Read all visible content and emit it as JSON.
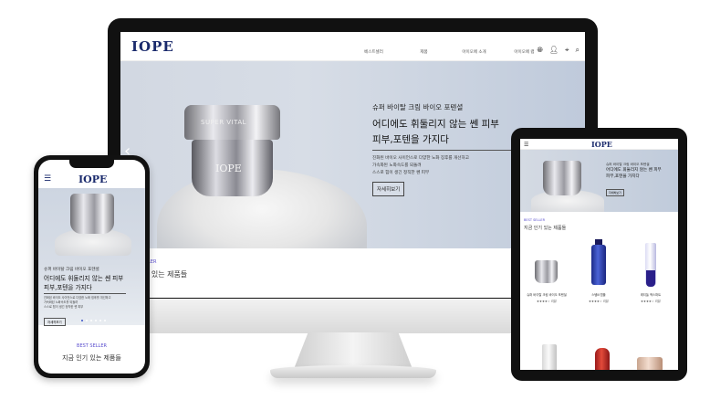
{
  "brand": "IOPE",
  "desktop": {
    "menu": [
      "베스트셀러",
      "제품",
      "아이오페 소개",
      "아이오페 랩"
    ],
    "icons": [
      "globe-icon",
      "user-icon",
      "location-icon",
      "search-icon"
    ],
    "hero": {
      "product_lid_text": "SUPER VITAL",
      "product_body_text": "IOPE",
      "subtitle": "슈퍼 바이탈 크림 바이오 포텐셜",
      "headline_line1": "어디에도 휘둘리지 않는 쎈 피부",
      "headline_line2": "피부,포텐을 가지다",
      "desc_line1": "진화된 바이오 사이언스로 다양한 노화 징후를 개선하고",
      "desc_line2": "가속화된 노화속도를 되돌려",
      "desc_line3": "스스로 힘이 생긴 정직한 쎈 피부",
      "button_label": "자세히보기",
      "active_slide": 1,
      "slide_count": 6
    },
    "best_seller_tag": "LER",
    "best_seller_title": "기 있는 제품들"
  },
  "tablet": {
    "hero": {
      "subtitle": "슈퍼 바이탈 크림 바이오 포텐셜",
      "headline_line1": "어디에도 휘둘리지 않는 쎈 피부",
      "headline_line2": "피부,포텐을 가지다",
      "button_label": "자세히보기"
    },
    "best_seller_tag": "BEST SELLER",
    "best_seller_title": "지금 인기 있는 제품들",
    "products": [
      {
        "name": "슈퍼 바이탈 크림 바이오 포텐셜",
        "stars": "★★★★☆ 리뷰"
      },
      {
        "name": "스템Ⅲ 앰플",
        "stars": "★★★★☆ 리뷰"
      },
      {
        "name": "레티놀 엑스퍼트",
        "stars": "★★★★☆ 리뷰"
      }
    ]
  },
  "phone": {
    "hero": {
      "subtitle": "슈퍼 바이탈 크림 바이오 포텐셜",
      "headline_line1": "어디에도 휘둘리지 않는 쎈 피부",
      "headline_line2": "피부,포텐을 가지다",
      "desc_line1": "진화된 바이오 사이언스로 다양한 노화 징후를 개선하고",
      "desc_line2": "가속화된 노화속도를 되돌려",
      "desc_line3": "스스로 힘이 생긴 정직한 쎈 피부",
      "button_label": "자세히보기"
    },
    "best_seller_tag": "BEST SELLER",
    "best_seller_title": "지금 인기 있는 제품들"
  },
  "colors": {
    "brand_navy": "#1a2a6c",
    "accent_purple": "#5b4fcf",
    "dot_active": "#3a52c9"
  }
}
